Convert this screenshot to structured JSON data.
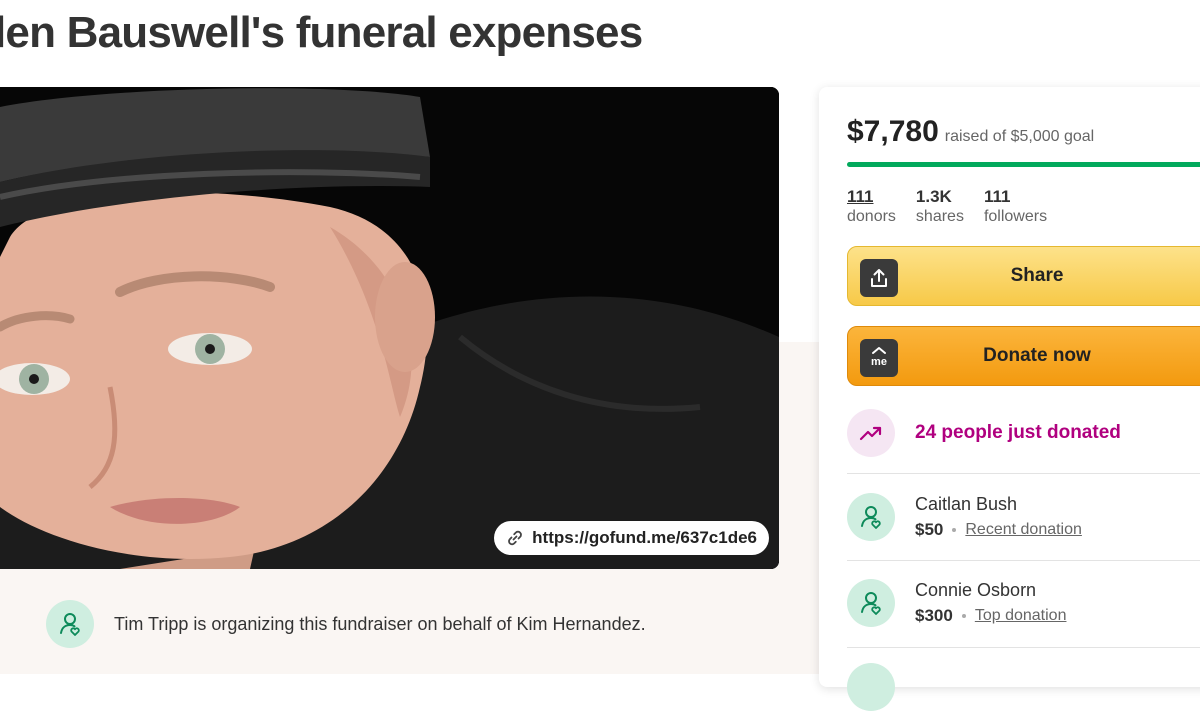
{
  "page": {
    "title": "len Bauswell's funeral expenses"
  },
  "hero": {
    "link_text": "https://gofund.me/637c1de6",
    "link_icon": "link-icon"
  },
  "organizer": {
    "text": "Tim Tripp is organizing this fundraiser on behalf of Kim Hernandez.",
    "icon": "heart-hand-icon"
  },
  "donation_card": {
    "raised_amount": "$7,780",
    "raised_goal_text": "raised of $5,000 goal",
    "progress_fraction": 1.0,
    "stats": [
      {
        "value": "111",
        "label": "donors"
      },
      {
        "value": "1.3K",
        "label": "shares"
      },
      {
        "value": "111",
        "label": "followers"
      }
    ],
    "share_label": "Share",
    "share_icon": "upload-share-icon",
    "donate_label": "Donate now",
    "donate_icon": "gofundme-me-icon",
    "donate_icon_text": "me",
    "trend_text": "24 people just donated",
    "trend_icon": "trending-up-icon",
    "donations": [
      {
        "name": "Caitlan Bush",
        "amount": "$50",
        "tag": "Recent donation"
      },
      {
        "name": "Connie Osborn",
        "amount": "$300",
        "tag": "Top donation"
      }
    ]
  },
  "colors": {
    "progress": "#02a95c",
    "share_button": "#f7c948",
    "donate_button": "#f39a0f",
    "trend_text": "#b0007f",
    "avatar_bg": "#cfeee0"
  }
}
